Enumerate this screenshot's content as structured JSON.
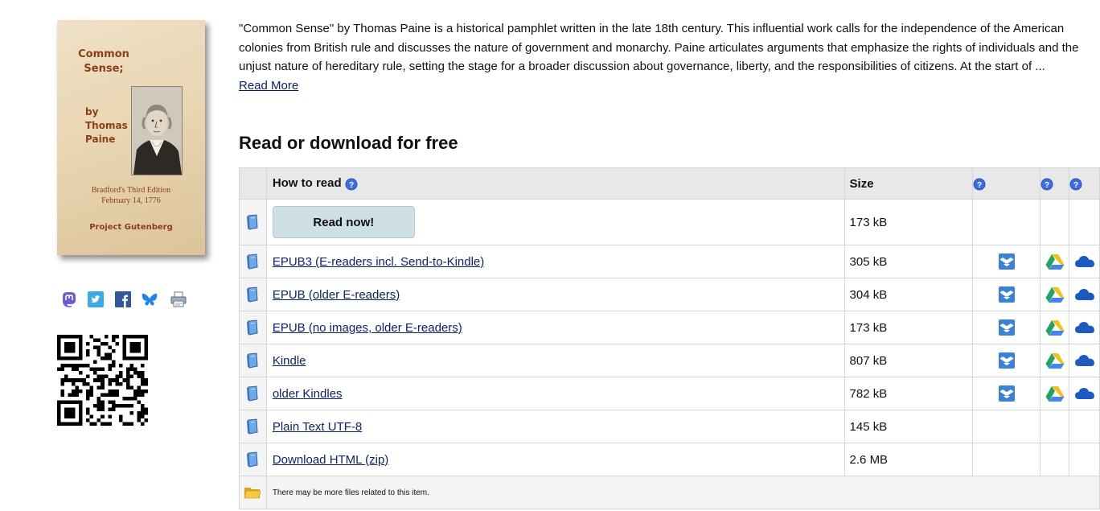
{
  "cover": {
    "title_line1": "Common",
    "title_line2": "Sense;",
    "by_line1": "by",
    "by_line2": "Thomas",
    "by_line3": "Paine",
    "edition_line1": "Bradford's Third  Edition",
    "edition_line2": "February 14, 1776",
    "publisher": "Project Gutenberg"
  },
  "summary": {
    "text": "\"Common Sense\" by Thomas Paine is a historical pamphlet written in the late 18th century. This influential work calls for the independence of the American colonies from British rule and discusses the nature of government and monarchy. Paine articulates arguments that emphasize the rights of individuals and the unjust nature of hereditary rule, setting the stage for a broader discussion about governance, liberty, and the responsibilities of citizens. At the start of ...",
    "read_more": "Read More"
  },
  "downloads": {
    "title": "Read or download for free",
    "header": {
      "how_to_read": "How to read",
      "size": "Size"
    },
    "read_now": {
      "label": "Read now!",
      "size": "173 kB"
    },
    "files": [
      {
        "name": "EPUB3 (E-readers incl. Send-to-Kindle)",
        "size": "305 kB",
        "cloud": true
      },
      {
        "name": "EPUB (older E-readers)",
        "size": "304 kB",
        "cloud": true
      },
      {
        "name": "EPUB (no images, older E-readers)",
        "size": "173 kB",
        "cloud": true
      },
      {
        "name": "Kindle",
        "size": "807 kB",
        "cloud": true
      },
      {
        "name": "older Kindles",
        "size": "782 kB",
        "cloud": true
      },
      {
        "name": "Plain Text UTF-8",
        "size": "145 kB",
        "cloud": false
      },
      {
        "name": "Download HTML (zip)",
        "size": "2.6 MB",
        "cloud": false
      }
    ],
    "more_files_note": "There may be more files related to this item."
  },
  "colors": {
    "link": "#0c1f6e",
    "read_now_bg": "#cfe0e5",
    "header_bg": "#e8e8e8",
    "cover_text": "#8a3f16"
  }
}
